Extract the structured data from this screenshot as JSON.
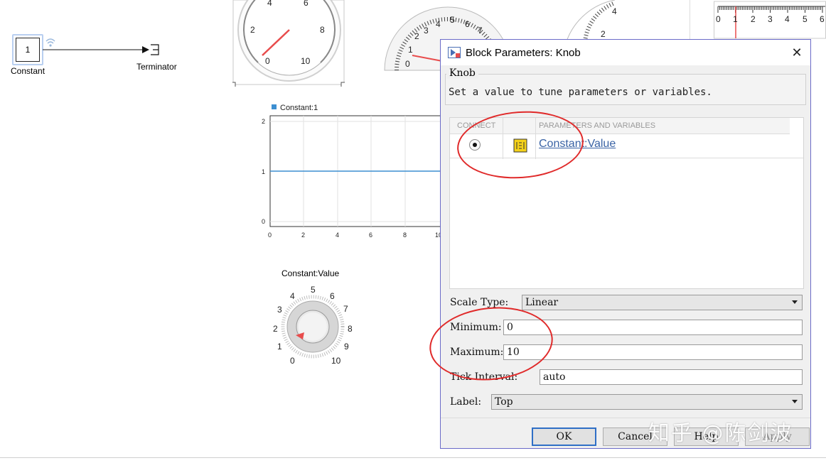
{
  "canvas": {
    "constant_block": {
      "value": "1",
      "label": "Constant"
    },
    "terminator_block": {
      "label": "Terminator"
    },
    "gauge1_ticks": [
      "0",
      "2",
      "4",
      "6",
      "8",
      "10"
    ],
    "gauge2_ticks": [
      "0",
      "1",
      "2",
      "3",
      "4",
      "5",
      "6",
      "7"
    ],
    "gauge3_ticks": [
      "2",
      "4"
    ],
    "ruler_ticks": [
      "0",
      "1",
      "2",
      "3",
      "4",
      "5",
      "6"
    ],
    "scope": {
      "legend": "Constant:1",
      "y_ticks": [
        "2",
        "1",
        "0"
      ],
      "x_ticks": [
        "0",
        "2",
        "4",
        "6",
        "8",
        "10"
      ]
    },
    "knob": {
      "label": "Constant:Value",
      "ticks": [
        "0",
        "1",
        "2",
        "3",
        "4",
        "5",
        "6",
        "7",
        "8",
        "9",
        "10"
      ]
    }
  },
  "dialog": {
    "title": "Block Parameters: Knob",
    "group_title": "Knob",
    "description": "Set a value to tune parameters or variables.",
    "table": {
      "col_connect": "CONNECT",
      "col_params": "PARAMETERS AND VARIABLES",
      "rows": [
        {
          "value": "Constant:Value",
          "connected": true
        }
      ]
    },
    "fields": {
      "scale_type_label": "Scale Type:",
      "scale_type_value": "Linear",
      "minimum_label": "Minimum:",
      "minimum_value": "0",
      "maximum_label": "Maximum:",
      "maximum_value": "10",
      "tick_interval_label": "Tick Interval:",
      "tick_interval_value": "auto",
      "label_label": "Label:",
      "label_value": "Top"
    },
    "buttons": {
      "ok": "OK",
      "cancel": "Cancel",
      "help": "Help",
      "apply": "Apply"
    }
  },
  "watermark": "知乎 @陈剑波",
  "colors": {
    "annotation_red": "#e02a2a",
    "link_blue": "#3a63a5",
    "scope_line": "#3d8fd1",
    "dialog_border": "#6b6bc8"
  }
}
